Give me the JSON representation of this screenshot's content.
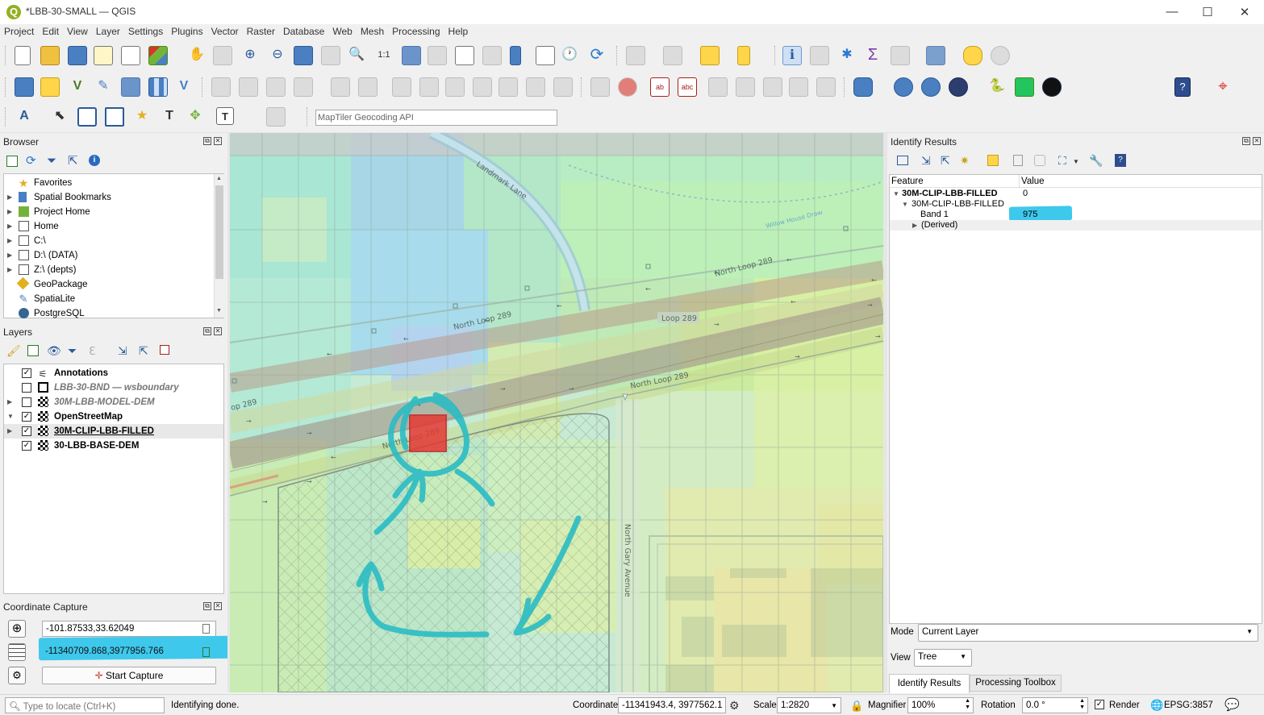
{
  "window": {
    "title": "*LBB-30-SMALL — QGIS",
    "minimize": "—",
    "maximize": "☐",
    "close": "✕"
  },
  "menu": [
    "Project",
    "Edit",
    "View",
    "Layer",
    "Settings",
    "Plugins",
    "Vector",
    "Raster",
    "Database",
    "Web",
    "Mesh",
    "Processing",
    "Help"
  ],
  "geocoder": {
    "placeholder": "MapTiler Geocoding API"
  },
  "browser": {
    "title": "Browser",
    "items": [
      {
        "label": "Favorites",
        "icon": "star-icon",
        "expandable": false
      },
      {
        "label": "Spatial Bookmarks",
        "icon": "bookmark-icon",
        "expandable": true
      },
      {
        "label": "Project Home",
        "icon": "project-home-icon",
        "expandable": true
      },
      {
        "label": "Home",
        "icon": "home-folder-icon",
        "expandable": true
      },
      {
        "label": "C:\\",
        "icon": "drive-icon",
        "expandable": true
      },
      {
        "label": "D:\\ (DATA)",
        "icon": "drive-icon",
        "expandable": true
      },
      {
        "label": "Z:\\ (depts)",
        "icon": "drive-icon",
        "expandable": true
      },
      {
        "label": "GeoPackage",
        "icon": "geopackage-icon",
        "expandable": false
      },
      {
        "label": "SpatiaLite",
        "icon": "spatialite-icon",
        "expandable": false
      },
      {
        "label": "PostgreSQL",
        "icon": "postgresql-icon",
        "expandable": false
      }
    ]
  },
  "layers": {
    "title": "Layers",
    "items": [
      {
        "label": "Annotations",
        "checked": true,
        "style": "bold",
        "expandable": false
      },
      {
        "label": "LBB-30-BND — wsboundary",
        "checked": false,
        "style": "italic",
        "expandable": false
      },
      {
        "label": "30M-LBB-MODEL-DEM",
        "checked": false,
        "style": "italic",
        "expandable": true
      },
      {
        "label": "OpenStreetMap",
        "checked": true,
        "style": "bold",
        "expandable": true
      },
      {
        "label": "30M-CLIP-LBB-FILLED",
        "checked": true,
        "style": "bold-underline",
        "expandable": true
      },
      {
        "label": "30-LBB-BASE-DEM",
        "checked": true,
        "style": "bold",
        "expandable": false
      }
    ]
  },
  "coordinate_capture": {
    "title": "Coordinate Capture",
    "geographic": "-101.87533,33.62049",
    "projected": "-11340709.868,3977956.766",
    "start_button": "Start Capture"
  },
  "map": {
    "labels": [
      "Landmark Lane",
      "North Loop 289",
      "North Loop 289",
      "Loop 289",
      "North Loop 289",
      "North Loop 289",
      "op 289",
      "North Gary Avenue",
      "Willow House Draw"
    ],
    "colors": {
      "highlight_red": "#e53935",
      "annotation_cyan": "#2bbcc4"
    }
  },
  "identify": {
    "title": "Identify Results",
    "col_feature": "Feature",
    "col_value": "Value",
    "rows": [
      {
        "feature": "30M-CLIP-LBB-FILLED",
        "value": "0"
      },
      {
        "feature": "30M-CLIP-LBB-FILLED",
        "value": ""
      },
      {
        "feature": "Band 1",
        "value": "975"
      },
      {
        "feature": "(Derived)",
        "value": ""
      }
    ],
    "mode_label": "Mode",
    "mode_value": "Current Layer",
    "view_label": "View",
    "view_value": "Tree",
    "tabs": [
      "Identify Results",
      "Processing Toolbox"
    ]
  },
  "status": {
    "locate_placeholder": "Type to locate (Ctrl+K)",
    "message": "Identifying done.",
    "coordinate_label": "Coordinate",
    "coordinate_value": "-11341943.4, 3977562.1",
    "scale_label": "Scale",
    "scale_value": "1:2820",
    "magnifier_label": "Magnifier",
    "magnifier_value": "100%",
    "rotation_label": "Rotation",
    "rotation_value": "0.0 °",
    "render_label": "Render",
    "crs": "EPSG:3857"
  }
}
